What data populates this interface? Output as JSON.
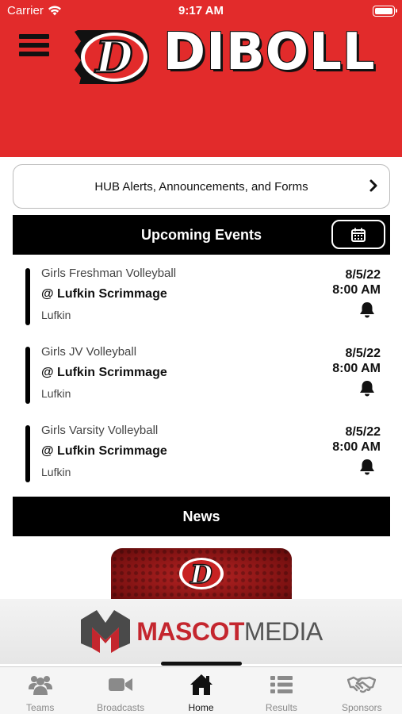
{
  "status_bar": {
    "carrier": "Carrier",
    "time": "9:17 AM"
  },
  "header": {
    "brand": "DIBOLL",
    "logo_letter": "D"
  },
  "alerts": {
    "label": "HUB Alerts, Announcements, and Forms"
  },
  "upcoming": {
    "title": "Upcoming Events",
    "events": [
      {
        "sport": "Girls Freshman Volleyball",
        "opponent": "@ Lufkin Scrimmage",
        "location": "Lufkin",
        "date": "8/5/22",
        "time": "8:00 AM"
      },
      {
        "sport": "Girls JV Volleyball",
        "opponent": "@ Lufkin Scrimmage",
        "location": "Lufkin",
        "date": "8/5/22",
        "time": "8:00 AM"
      },
      {
        "sport": "Girls Varsity Volleyball",
        "opponent": "@ Lufkin Scrimmage",
        "location": "Lufkin",
        "date": "8/5/22",
        "time": "8:00 AM"
      }
    ]
  },
  "news": {
    "title": "News",
    "logo_letter": "D"
  },
  "sponsor": {
    "name_part1": "MASCOT",
    "name_part2": "MEDIA"
  },
  "tabs": [
    {
      "label": "Teams",
      "icon": "users-icon"
    },
    {
      "label": "Broadcasts",
      "icon": "video-camera-icon"
    },
    {
      "label": "Home",
      "icon": "home-icon"
    },
    {
      "label": "Results",
      "icon": "list-icon"
    },
    {
      "label": "Sponsors",
      "icon": "handshake-icon"
    }
  ],
  "colors": {
    "brand_red": "#e22b2b",
    "black": "#000000",
    "mascot_red": "#c4262e"
  }
}
